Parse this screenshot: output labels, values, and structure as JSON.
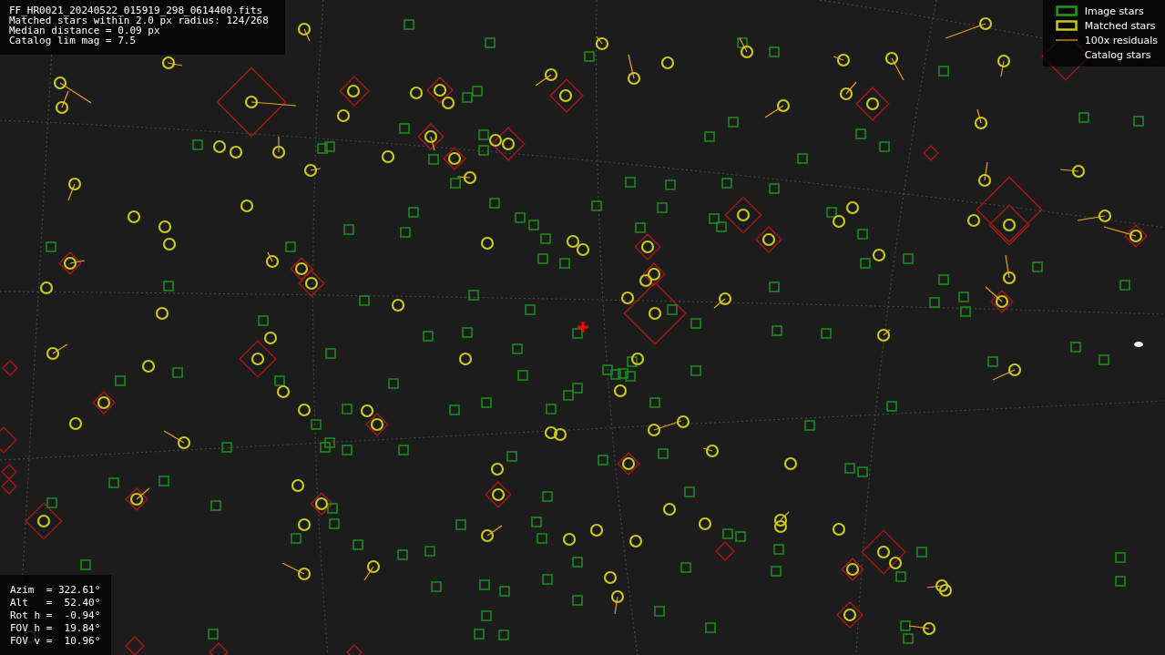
{
  "info": {
    "lines": [
      "FF_HR0021_20240522_015919_298_0614400.fits",
      "Matched stars within 2.0 px radius: 124/268",
      "Median distance = 0.09 px",
      "Catalog lim mag = 7.5"
    ]
  },
  "legend": [
    {
      "kind": "image",
      "label": "Image stars"
    },
    {
      "kind": "matched",
      "label": "Matched stars"
    },
    {
      "kind": "residual",
      "label": "100x residuals"
    },
    {
      "kind": "catalog",
      "label": "Catalog stars"
    }
  ],
  "pointing": {
    "lines": [
      "Azim  = 322.61°",
      "Alt   =  52.40°",
      "Rot h =  -0.94°",
      "FOV h =  19.84°",
      "FOV v =  10.96°"
    ]
  }
}
